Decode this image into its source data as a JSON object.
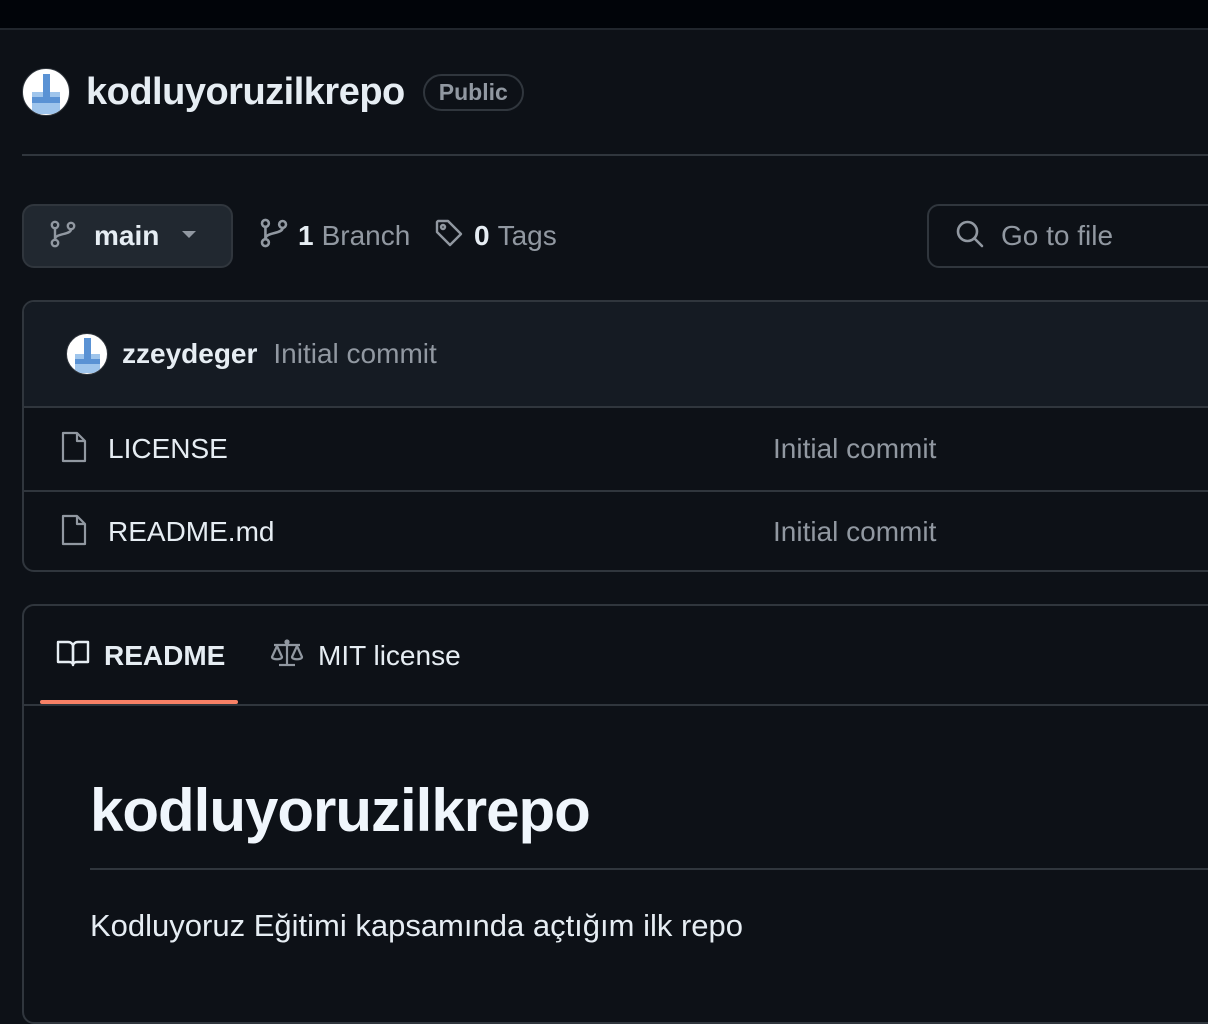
{
  "repo": {
    "name": "kodluyoruzilkrepo",
    "visibility": "Public"
  },
  "toolbar": {
    "branch": "main",
    "branch_count": "1",
    "branch_label": "Branch",
    "tag_count": "0",
    "tag_label": "Tags",
    "search_placeholder": "Go to file"
  },
  "latest_commit": {
    "author": "zzeydeger",
    "message": "Initial commit"
  },
  "files": [
    {
      "name": "LICENSE",
      "commit": "Initial commit",
      "icon": "file-icon"
    },
    {
      "name": "README.md",
      "commit": "Initial commit",
      "icon": "file-icon"
    }
  ],
  "readme": {
    "tabs": [
      {
        "label": "README",
        "icon": "book-icon",
        "active": true
      },
      {
        "label": "MIT license",
        "icon": "law-icon",
        "active": false
      }
    ],
    "heading": "kodluyoruzilkrepo",
    "paragraph": "Kodluyoruz Eğitimi kapsamında açtığım ilk repo"
  },
  "colors": {
    "background": "#0d1117",
    "border": "#30363d",
    "muted_text": "#9198a1",
    "active_tab_underline": "#f78166"
  }
}
